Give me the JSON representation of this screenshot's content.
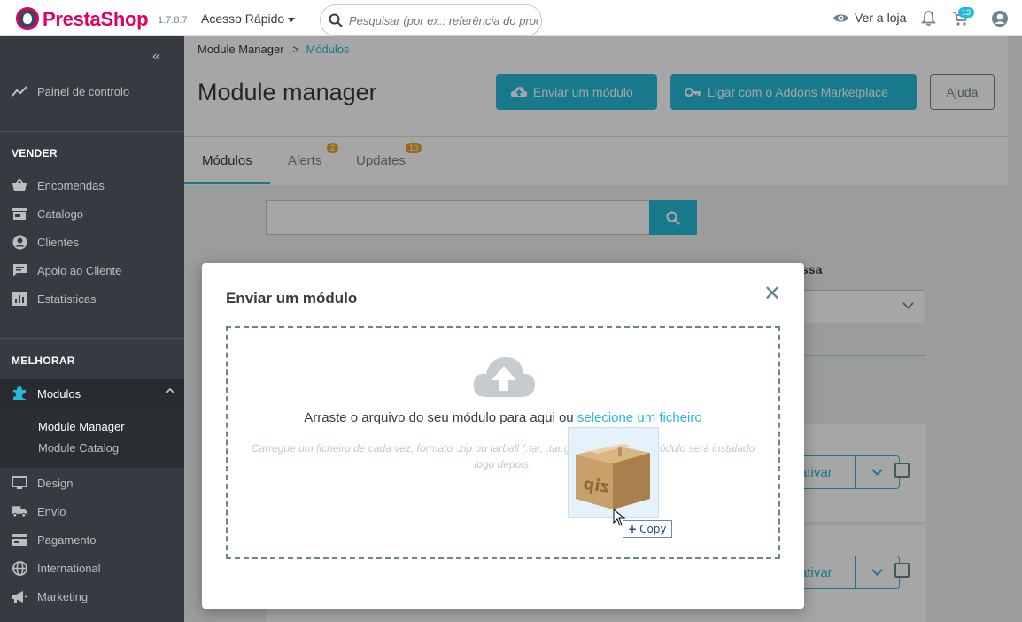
{
  "header": {
    "brand": "PrestaShop",
    "version": "1.7.8.7",
    "quick_access": "Acesso Rápido",
    "search_placeholder": "Pesquisar (por ex.: referência do produto",
    "view_shop": "Ver a loja",
    "cart_count": "13"
  },
  "sidebar": {
    "dashboard": "Painel de controlo",
    "section_sell": "VENDER",
    "sell_items": [
      "Encomendas",
      "Catalogo",
      "Clientes",
      "Apoio ao Cliente",
      "Estatísticas"
    ],
    "section_improve": "MELHORAR",
    "modules": "Modulos",
    "sub_items": [
      "Module Manager",
      "Module Catalog"
    ],
    "improve_items": [
      "Design",
      "Envio",
      "Pagamento",
      "International",
      "Marketing"
    ]
  },
  "page": {
    "breadcrumb_parent": "Module Manager",
    "breadcrumb_sep": ">",
    "breadcrumb_current": "Módulos",
    "title": "Module manager",
    "upload_button": "Enviar um módulo",
    "connect_button": "Ligar com o Addons Marketplace",
    "help_button": "Ajuda",
    "tabs": [
      {
        "label": "Módulos",
        "badge": ""
      },
      {
        "label": "Alerts",
        "badge": "2"
      },
      {
        "label": "Updates",
        "badge": "10"
      }
    ]
  },
  "background": {
    "filter_label": "ssa",
    "action_label": "ativar"
  },
  "modal": {
    "title": "Enviar um módulo",
    "drop_text": "Arraste o arquivo do seu módulo para aqui ou",
    "drop_link": "selecione um ficheiro",
    "help_text": "Carregue um ficheiro de cada vez, formato .zip ou tarball (.tar, .tar.gz ou .tgz). O seu módulo será instalado logo depois.",
    "drag_tooltip": "Copy"
  },
  "colors": {
    "accent": "#25b9d7",
    "sidebar": "#363a41",
    "brand": "#df0067",
    "badge": "#f0a127"
  }
}
